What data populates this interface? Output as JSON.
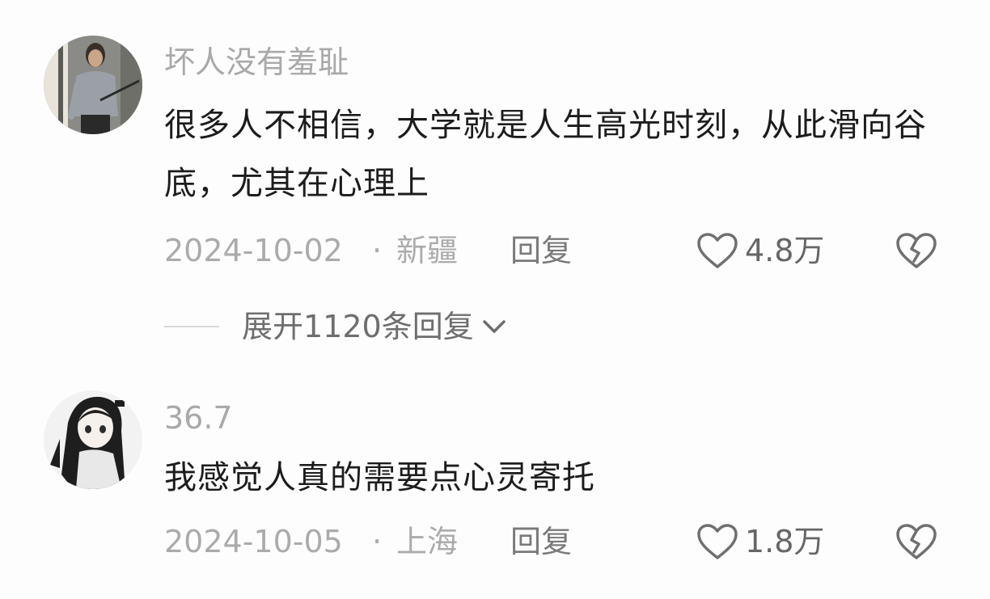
{
  "comments": [
    {
      "username": "坏人没有羞耻",
      "text": "很多人不相信，大学就是人生高光时刻，从此滑向谷底，尤其在心理上",
      "date": "2024-10-02",
      "separator": "·",
      "location": "新疆",
      "reply_label": "回复",
      "likes": "4.8万",
      "avatar_icon": "user-photo-avatar"
    },
    {
      "username": "36.7",
      "text": "我感觉人真的需要点心灵寄托",
      "date": "2024-10-05",
      "separator": "·",
      "location": "上海",
      "reply_label": "回复",
      "likes": "1.8万",
      "avatar_icon": "anime-girl-avatar"
    }
  ],
  "expand_replies": {
    "label": "展开1120条回复",
    "icon": "chevron-down-icon"
  },
  "icons": {
    "like": "heart-icon",
    "dislike": "broken-heart-icon"
  },
  "colors": {
    "background": "#fdfdfd",
    "username": "#a9a9a9",
    "text": "#1c1c1c",
    "meta": "#ababab"
  }
}
